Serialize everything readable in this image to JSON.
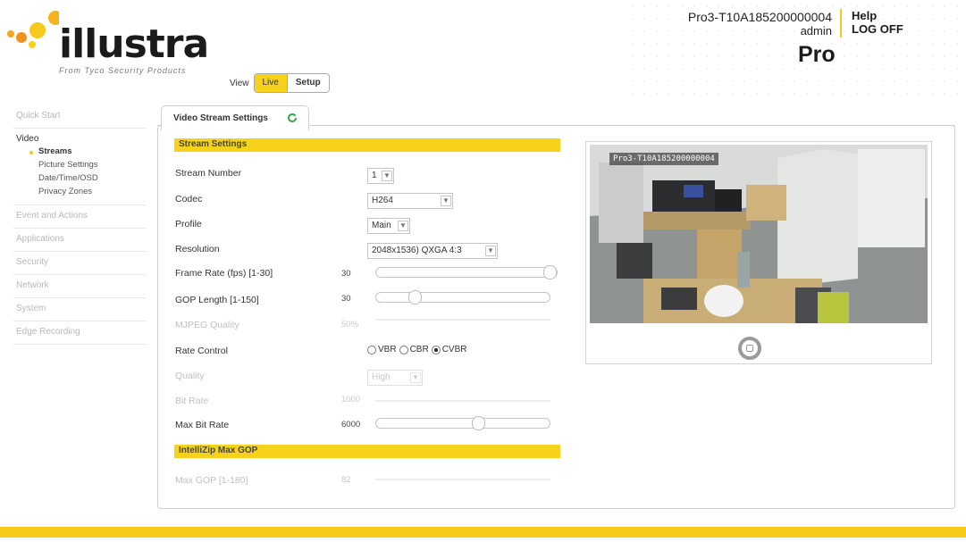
{
  "brand": {
    "logo_word": "illustra",
    "tagline": "From Tyco Security Products",
    "edition": "Pro"
  },
  "header": {
    "device_id": "Pro3-T10A185200000004",
    "user": "admin",
    "help": "Help",
    "logoff": "LOG OFF"
  },
  "view": {
    "label": "View",
    "live": "Live",
    "setup": "Setup"
  },
  "sidebar": {
    "quick_start": "Quick Start",
    "video": "Video",
    "video_items": [
      "Streams",
      "Picture Settings",
      "Date/Time/OSD",
      "Privacy Zones"
    ],
    "categories": [
      "Event and Actions",
      "Applications",
      "Security",
      "Network",
      "System",
      "Edge Recording"
    ]
  },
  "tab": {
    "label": "Video Stream Settings"
  },
  "stream_settings": {
    "section_title": "Stream Settings",
    "stream_number": {
      "label": "Stream Number",
      "value": "1"
    },
    "codec": {
      "label": "Codec",
      "value": "H264"
    },
    "profile": {
      "label": "Profile",
      "value": "Main"
    },
    "resolution": {
      "label": "Resolution",
      "value": "2048x1536) QXGA 4:3"
    },
    "frame_rate": {
      "label": "Frame Rate (fps) [1-30]",
      "value": "30",
      "fraction": 1.0
    },
    "gop_length": {
      "label": "GOP Length [1-150]",
      "value": "30",
      "fraction": 0.2
    },
    "mjpeg_quality": {
      "label": "MJPEG Quality",
      "value": "50%"
    },
    "rate_control": {
      "label": "Rate Control",
      "options": [
        "VBR",
        "CBR",
        "CVBR"
      ],
      "selected": "CVBR"
    },
    "quality": {
      "label": "Quality",
      "value": "High"
    },
    "bit_rate": {
      "label": "Bit Rate",
      "value": "1000"
    },
    "max_bit_rate": {
      "label": "Max Bit Rate",
      "value": "6000",
      "fraction": 0.6
    }
  },
  "intellizip": {
    "section_title": "IntelliZip Max GOP",
    "max_gop": {
      "label": "Max GOP [1-180]",
      "value": "82"
    }
  },
  "preview": {
    "caption": "Pro3-T10A185200000004"
  },
  "colors": {
    "accent": "#f7d21b",
    "footer": "#f7c91b"
  }
}
